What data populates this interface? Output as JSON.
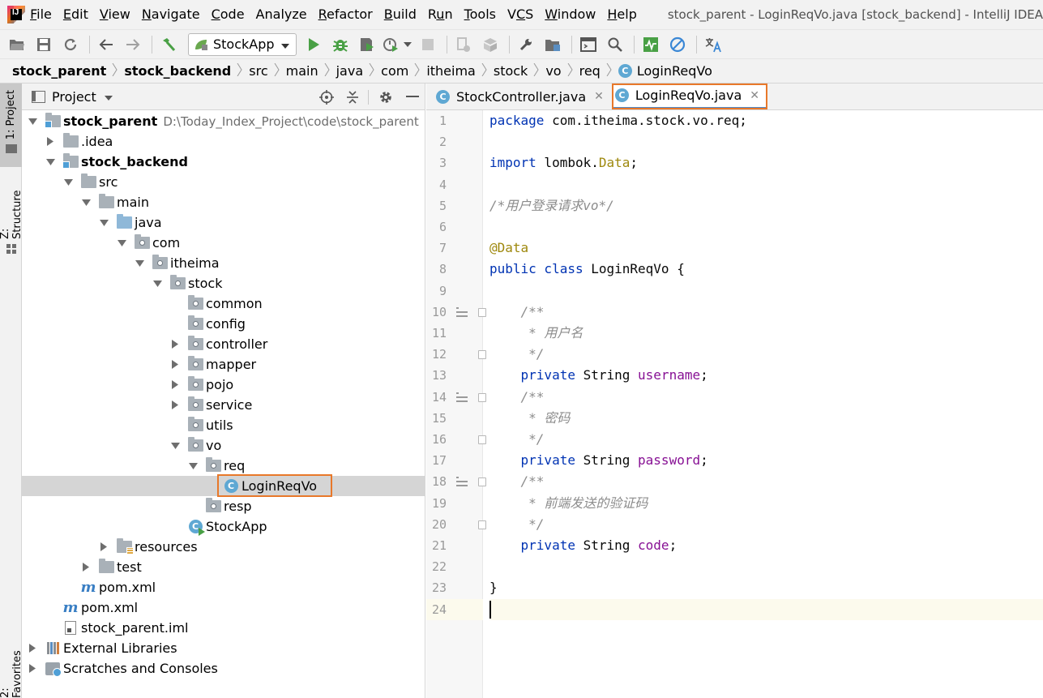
{
  "menu": {
    "items": [
      {
        "label": "File",
        "mnemonic_index": 0
      },
      {
        "label": "Edit",
        "mnemonic_index": 0
      },
      {
        "label": "View",
        "mnemonic_index": 0
      },
      {
        "label": "Navigate",
        "mnemonic_index": 0
      },
      {
        "label": "Code",
        "mnemonic_index": 0
      },
      {
        "label": "Analyze",
        "mnemonic_index": -1
      },
      {
        "label": "Refactor",
        "mnemonic_index": 0
      },
      {
        "label": "Build",
        "mnemonic_index": 0
      },
      {
        "label": "Run",
        "mnemonic_index": 1
      },
      {
        "label": "Tools",
        "mnemonic_index": 0
      },
      {
        "label": "VCS",
        "mnemonic_index": 1
      },
      {
        "label": "Window",
        "mnemonic_index": 0
      },
      {
        "label": "Help",
        "mnemonic_index": 0
      }
    ],
    "window_title": "stock_parent - LoginReqVo.java [stock_backend] - IntelliJ IDEA"
  },
  "toolbar": {
    "run_config": "StockApp"
  },
  "breadcrumb": [
    {
      "label": "stock_parent",
      "bold": true
    },
    {
      "label": "stock_backend",
      "bold": true
    },
    {
      "label": "src",
      "bold": false
    },
    {
      "label": "main",
      "bold": false
    },
    {
      "label": "java",
      "bold": false
    },
    {
      "label": "com",
      "bold": false
    },
    {
      "label": "itheima",
      "bold": false
    },
    {
      "label": "stock",
      "bold": false
    },
    {
      "label": "vo",
      "bold": false
    },
    {
      "label": "req",
      "bold": false
    },
    {
      "label": "LoginReqVo",
      "bold": false,
      "icon": "class-icon"
    }
  ],
  "left_stripe": {
    "project": "1: Project",
    "structure": "Z: Structure",
    "favorites": "2: Favorites"
  },
  "project_panel": {
    "title": "Project",
    "tree": [
      {
        "label": "stock_parent",
        "path": "D:\\Today_Index_Project\\code\\stock_parent",
        "depth": 0,
        "arrow": "down",
        "icon": "module-folder",
        "bold": true
      },
      {
        "label": ".idea",
        "depth": 1,
        "arrow": "right",
        "icon": "folder"
      },
      {
        "label": "stock_backend",
        "depth": 1,
        "arrow": "down",
        "icon": "module-folder",
        "bold": true
      },
      {
        "label": "src",
        "depth": 2,
        "arrow": "down",
        "icon": "folder"
      },
      {
        "label": "main",
        "depth": 3,
        "arrow": "down",
        "icon": "folder"
      },
      {
        "label": "java",
        "depth": 4,
        "arrow": "down",
        "icon": "source-folder"
      },
      {
        "label": "com",
        "depth": 5,
        "arrow": "down",
        "icon": "package"
      },
      {
        "label": "itheima",
        "depth": 6,
        "arrow": "down",
        "icon": "package"
      },
      {
        "label": "stock",
        "depth": 7,
        "arrow": "down",
        "icon": "package"
      },
      {
        "label": "common",
        "depth": 8,
        "arrow": "none",
        "icon": "package"
      },
      {
        "label": "config",
        "depth": 8,
        "arrow": "none",
        "icon": "package"
      },
      {
        "label": "controller",
        "depth": 8,
        "arrow": "right",
        "icon": "package"
      },
      {
        "label": "mapper",
        "depth": 8,
        "arrow": "right",
        "icon": "package"
      },
      {
        "label": "pojo",
        "depth": 8,
        "arrow": "right",
        "icon": "package"
      },
      {
        "label": "service",
        "depth": 8,
        "arrow": "right",
        "icon": "package"
      },
      {
        "label": "utils",
        "depth": 8,
        "arrow": "none",
        "icon": "package"
      },
      {
        "label": "vo",
        "depth": 8,
        "arrow": "down",
        "icon": "package"
      },
      {
        "label": "req",
        "depth": 9,
        "arrow": "down",
        "icon": "package"
      },
      {
        "label": "LoginReqVo",
        "depth": 10,
        "arrow": "none",
        "icon": "class",
        "selected": true
      },
      {
        "label": "resp",
        "depth": 9,
        "arrow": "none",
        "icon": "package"
      },
      {
        "label": "StockApp",
        "depth": 8,
        "arrow": "none",
        "icon": "app-class"
      },
      {
        "label": "resources",
        "depth": 4,
        "arrow": "right",
        "icon": "resources-folder"
      },
      {
        "label": "test",
        "depth": 3,
        "arrow": "right",
        "icon": "folder"
      },
      {
        "label": "pom.xml",
        "depth": 2,
        "arrow": "none",
        "icon": "maven"
      },
      {
        "label": "pom.xml",
        "depth": 1,
        "arrow": "none",
        "icon": "maven"
      },
      {
        "label": "stock_parent.iml",
        "depth": 1,
        "arrow": "none",
        "icon": "iml"
      },
      {
        "label": "External Libraries",
        "depth": 0,
        "arrow": "right",
        "icon": "libraries"
      },
      {
        "label": "Scratches and Consoles",
        "depth": 0,
        "arrow": "right",
        "icon": "scratches"
      }
    ]
  },
  "editor": {
    "tabs": [
      {
        "label": "StockController.java",
        "active": false
      },
      {
        "label": "LoginReqVo.java",
        "active": true
      }
    ],
    "lines": [
      [
        {
          "t": "package",
          "c": "kw"
        },
        {
          "t": " com.itheima.stock.vo.req;",
          "c": ""
        }
      ],
      [],
      [
        {
          "t": "import",
          "c": "kw"
        },
        {
          "t": " lombok.",
          "c": ""
        },
        {
          "t": "Data",
          "c": "ann"
        },
        {
          "t": ";",
          "c": ""
        }
      ],
      [],
      [
        {
          "t": "/*用户登录请求vo*/",
          "c": "cmt"
        }
      ],
      [],
      [
        {
          "t": "@Data",
          "c": "ann"
        }
      ],
      [
        {
          "t": "public class",
          "c": "kw"
        },
        {
          "t": " LoginReqVo {",
          "c": ""
        }
      ],
      [],
      [
        {
          "t": "    /**",
          "c": "cmt"
        }
      ],
      [
        {
          "t": "     * 用户名",
          "c": "cmt"
        }
      ],
      [
        {
          "t": "     */",
          "c": "cmt"
        }
      ],
      [
        {
          "t": "    ",
          "c": ""
        },
        {
          "t": "private",
          "c": "kw"
        },
        {
          "t": " String ",
          "c": ""
        },
        {
          "t": "username",
          "c": "fld"
        },
        {
          "t": ";",
          "c": ""
        }
      ],
      [
        {
          "t": "    /**",
          "c": "cmt"
        }
      ],
      [
        {
          "t": "     * 密码",
          "c": "cmt"
        }
      ],
      [
        {
          "t": "     */",
          "c": "cmt"
        }
      ],
      [
        {
          "t": "    ",
          "c": ""
        },
        {
          "t": "private",
          "c": "kw"
        },
        {
          "t": " String ",
          "c": ""
        },
        {
          "t": "password",
          "c": "fld"
        },
        {
          "t": ";",
          "c": ""
        }
      ],
      [
        {
          "t": "    /**",
          "c": "cmt"
        }
      ],
      [
        {
          "t": "     * 前端发送的验证码",
          "c": "cmt"
        }
      ],
      [
        {
          "t": "     */",
          "c": "cmt"
        }
      ],
      [
        {
          "t": "    ",
          "c": ""
        },
        {
          "t": "private",
          "c": "kw"
        },
        {
          "t": " String ",
          "c": ""
        },
        {
          "t": "code",
          "c": "fld"
        },
        {
          "t": ";",
          "c": ""
        }
      ],
      [],
      [
        {
          "t": "}",
          "c": ""
        }
      ],
      []
    ],
    "line_numbers": [
      "1",
      "2",
      "3",
      "4",
      "5",
      "6",
      "7",
      "8",
      "9",
      "10",
      "11",
      "12",
      "13",
      "14",
      "15",
      "16",
      "17",
      "18",
      "19",
      "20",
      "21",
      "22",
      "23",
      "24"
    ],
    "gutter_marks": [
      10,
      14,
      18
    ],
    "fold_markers": [
      10,
      12,
      14,
      16,
      18,
      20
    ],
    "caret_line": 24
  }
}
